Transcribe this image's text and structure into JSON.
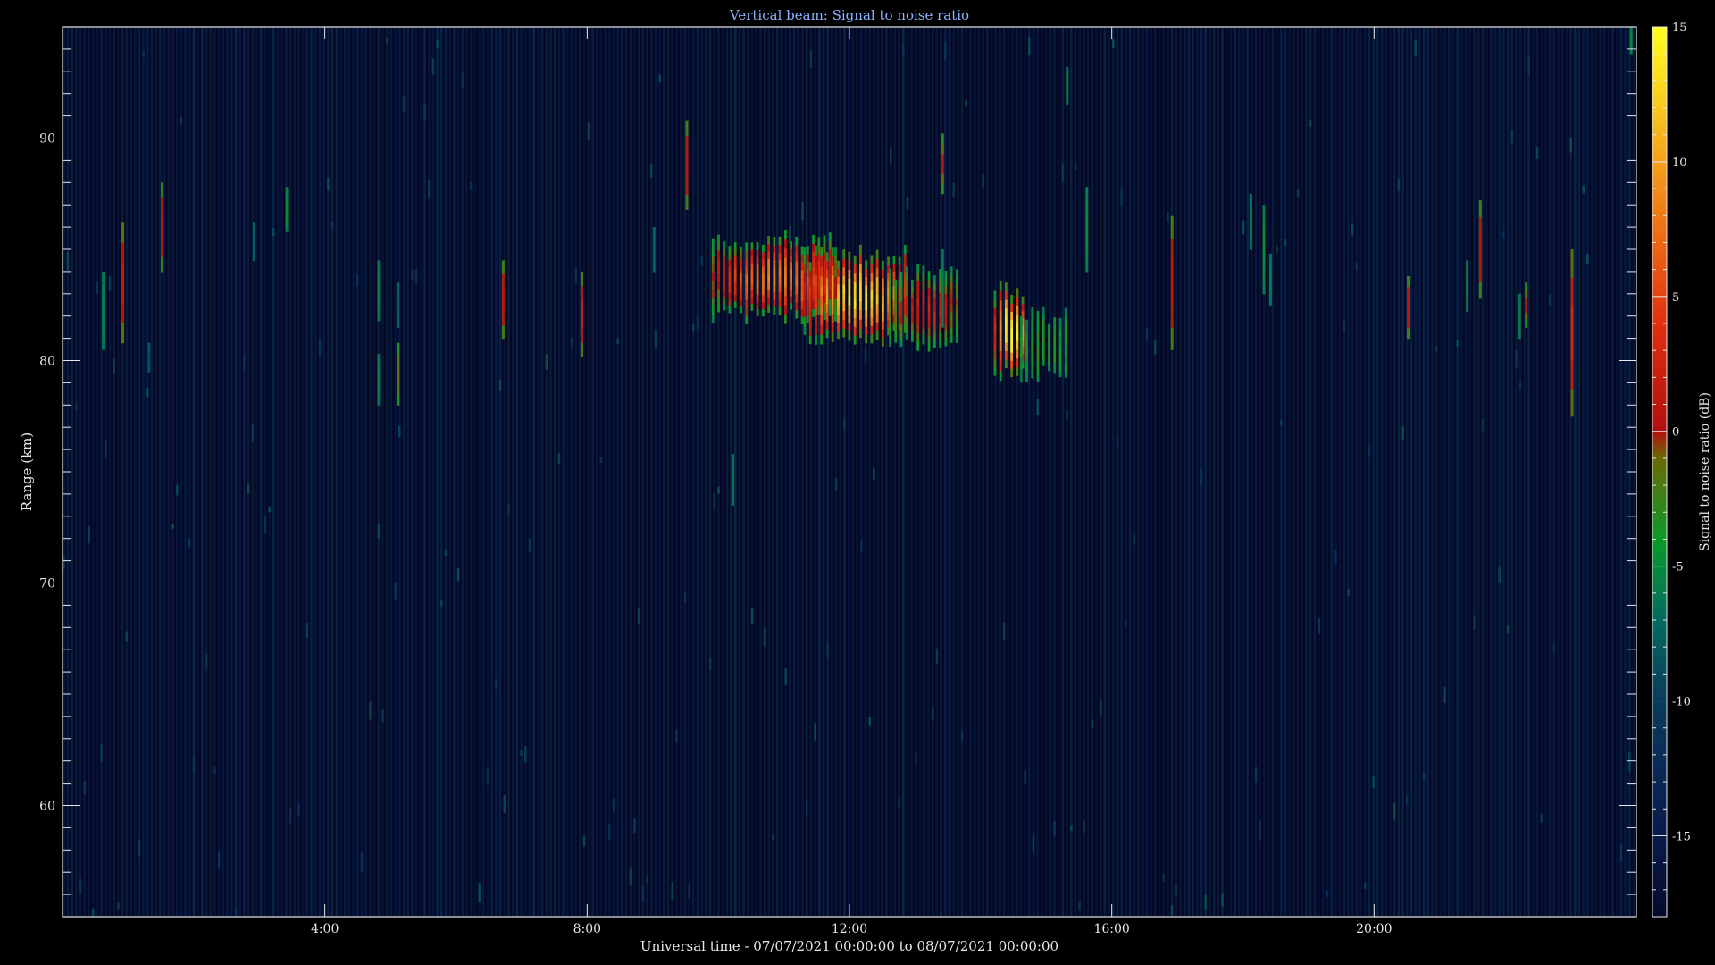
{
  "chart_data": {
    "type": "heatmap",
    "title": "Vertical beam: Signal to noise ratio",
    "xlabel": "Universal time - 07/07/2021 00:00:00 to 08/07/2021 00:00:00",
    "ylabel": "Range (km)",
    "colorbar_label": "Signal to noise ratio (dB)",
    "x_unit": "hours UT",
    "xlim": [
      0,
      24
    ],
    "ylim": [
      55,
      95
    ],
    "x_ticks": [
      {
        "value": 4,
        "label": "4:00"
      },
      {
        "value": 8,
        "label": "8:00"
      },
      {
        "value": 12,
        "label": "12:00"
      },
      {
        "value": 16,
        "label": "16:00"
      },
      {
        "value": 20,
        "label": "20:00"
      }
    ],
    "y_ticks": [
      {
        "value": 60,
        "label": "60"
      },
      {
        "value": 70,
        "label": "70"
      },
      {
        "value": 80,
        "label": "80"
      },
      {
        "value": 90,
        "label": "90"
      }
    ],
    "colorbar_range": [
      -18,
      15
    ],
    "colorbar_ticks": [
      {
        "value": -15,
        "label": "-15"
      },
      {
        "value": -10,
        "label": "-10"
      },
      {
        "value": -5,
        "label": "-5"
      },
      {
        "value": 0,
        "label": "0"
      },
      {
        "value": 5,
        "label": "5"
      },
      {
        "value": 10,
        "label": "10"
      },
      {
        "value": 15,
        "label": "15"
      }
    ],
    "colormap": [
      {
        "value": -18,
        "color": "#050a2a"
      },
      {
        "value": -15,
        "color": "#0a1a4a"
      },
      {
        "value": -10,
        "color": "#0a3a5c"
      },
      {
        "value": -7,
        "color": "#066a60"
      },
      {
        "value": -4,
        "color": "#0a9a2a"
      },
      {
        "value": -1,
        "color": "#6a6a08"
      },
      {
        "value": 0,
        "color": "#b01010"
      },
      {
        "value": 4,
        "color": "#e03010"
      },
      {
        "value": 8,
        "color": "#f07a18"
      },
      {
        "value": 12,
        "color": "#f8c820"
      },
      {
        "value": 15,
        "color": "#ffff20"
      }
    ],
    "background_snr": -14,
    "layers": [
      {
        "t_start": 9.9,
        "t_end": 11.8,
        "range_low": 82.0,
        "range_high": 85.5,
        "peak_snr": 8
      },
      {
        "t_start": 11.3,
        "t_end": 12.9,
        "range_low": 81.0,
        "range_high": 84.8,
        "peak_snr": 13
      },
      {
        "t_start": 12.6,
        "t_end": 13.7,
        "range_low": 80.8,
        "range_high": 84.0,
        "peak_snr": 2
      },
      {
        "t_start": 14.2,
        "t_end": 14.7,
        "range_low": 79.5,
        "range_high": 83.2,
        "peak_snr": 15
      },
      {
        "t_start": 14.6,
        "t_end": 15.3,
        "range_low": 79.4,
        "range_high": 82.0,
        "peak_snr": -3
      }
    ],
    "echo_streaks": [
      {
        "t": 0.6,
        "range_low": 80.5,
        "range_high": 84.0,
        "snr": -6
      },
      {
        "t": 0.9,
        "range_low": 80.8,
        "range_high": 86.2,
        "snr": 2
      },
      {
        "t": 1.5,
        "range_low": 84.0,
        "range_high": 88.0,
        "snr": 1
      },
      {
        "t": 1.3,
        "range_low": 79.5,
        "range_high": 80.8,
        "snr": -9
      },
      {
        "t": 2.9,
        "range_low": 84.5,
        "range_high": 86.2,
        "snr": -8
      },
      {
        "t": 3.4,
        "range_low": 85.8,
        "range_high": 87.8,
        "snr": -5
      },
      {
        "t": 4.8,
        "range_low": 81.8,
        "range_high": 84.5,
        "snr": -6
      },
      {
        "t": 5.1,
        "range_low": 81.5,
        "range_high": 83.5,
        "snr": -8
      },
      {
        "t": 4.8,
        "range_low": 78.0,
        "range_high": 80.3,
        "snr": -6
      },
      {
        "t": 5.1,
        "range_low": 78.0,
        "range_high": 80.8,
        "snr": -1
      },
      {
        "t": 6.7,
        "range_low": 81.0,
        "range_high": 84.5,
        "snr": 1
      },
      {
        "t": 7.9,
        "range_low": 80.2,
        "range_high": 84.0,
        "snr": 2
      },
      {
        "t": 9.5,
        "range_low": 86.8,
        "range_high": 90.8,
        "snr": 1
      },
      {
        "t": 9.0,
        "range_low": 84.0,
        "range_high": 86.0,
        "snr": -8
      },
      {
        "t": 10.2,
        "range_low": 73.5,
        "range_high": 75.8,
        "snr": -6
      },
      {
        "t": 13.4,
        "range_low": 87.5,
        "range_high": 90.2,
        "snr": 0
      },
      {
        "t": 13.4,
        "range_low": 81.5,
        "range_high": 85.0,
        "snr": -6
      },
      {
        "t": 15.6,
        "range_low": 84.0,
        "range_high": 87.8,
        "snr": -5
      },
      {
        "t": 15.3,
        "range_low": 91.5,
        "range_high": 93.2,
        "snr": -6
      },
      {
        "t": 16.9,
        "range_low": 80.5,
        "range_high": 86.5,
        "snr": 1
      },
      {
        "t": 18.1,
        "range_low": 85.0,
        "range_high": 87.5,
        "snr": -6
      },
      {
        "t": 18.3,
        "range_low": 83.0,
        "range_high": 87.0,
        "snr": -5
      },
      {
        "t": 18.4,
        "range_low": 82.5,
        "range_high": 84.8,
        "snr": -6
      },
      {
        "t": 20.5,
        "range_low": 81.0,
        "range_high": 83.8,
        "snr": 1
      },
      {
        "t": 21.4,
        "range_low": 82.2,
        "range_high": 84.5,
        "snr": -6
      },
      {
        "t": 21.6,
        "range_low": 82.8,
        "range_high": 87.2,
        "snr": 1
      },
      {
        "t": 22.2,
        "range_low": 81.0,
        "range_high": 83.0,
        "snr": -6
      },
      {
        "t": 22.3,
        "range_low": 81.5,
        "range_high": 83.5,
        "snr": 0
      },
      {
        "t": 23.0,
        "range_low": 77.5,
        "range_high": 85.0,
        "snr": 3
      },
      {
        "t": 23.9,
        "range_low": 93.8,
        "range_high": 95.0,
        "snr": -5
      }
    ]
  }
}
